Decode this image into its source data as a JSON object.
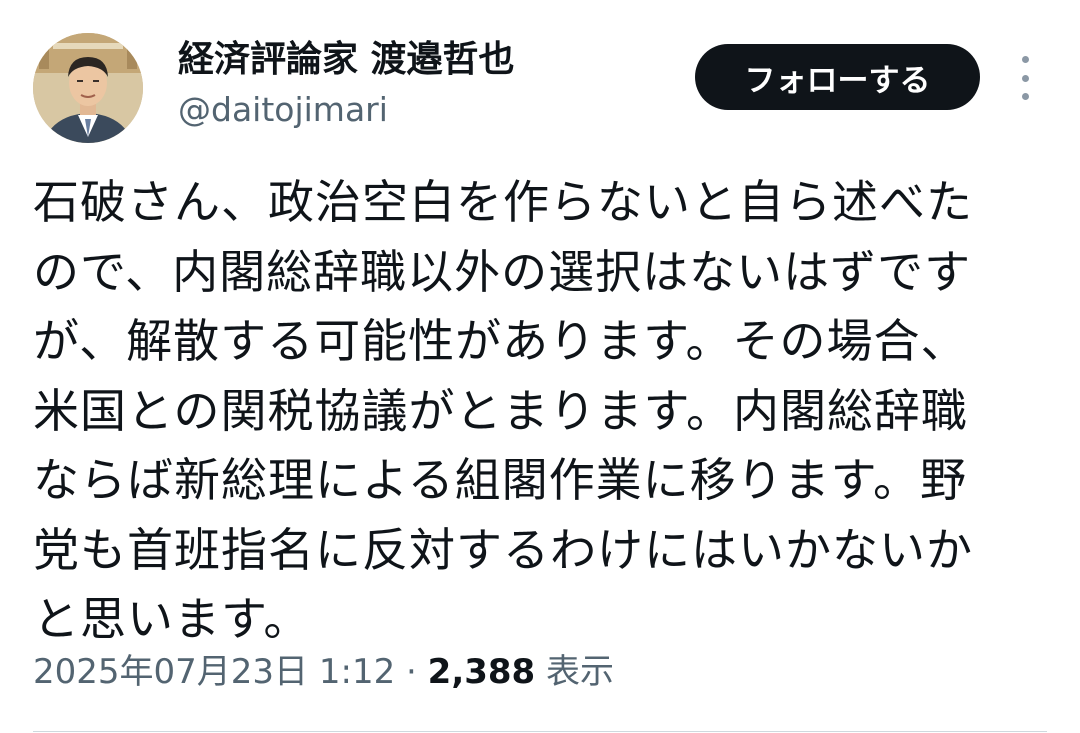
{
  "author": {
    "display_name": "経済評論家 渡邉哲也",
    "handle": "@daitojimari"
  },
  "follow_button": {
    "label": "フォローする"
  },
  "tweet": {
    "lines": [
      "石破さん、政治空白を作らないと自ら述べた",
      "ので、内閣総辞職以外の選択はないはずです",
      "が、解散する可能性があります。その場合、",
      "米国との関税協議がとまります。内閣総辞職",
      "ならば新総理による組閣作業に移ります。野",
      "党も首班指名に反対するわけにはいかないか",
      "と思います。"
    ],
    "timestamp": "2025年07月23日 1:12",
    "separator": " · ",
    "views_count": "2,388",
    "views_label": " 表示"
  },
  "icons": {
    "more": "more-vertical-icon"
  },
  "colors": {
    "text_primary": "#0f1419",
    "text_secondary": "#536471",
    "follow_bg": "#0f1419",
    "divider": "#cfd9de"
  }
}
